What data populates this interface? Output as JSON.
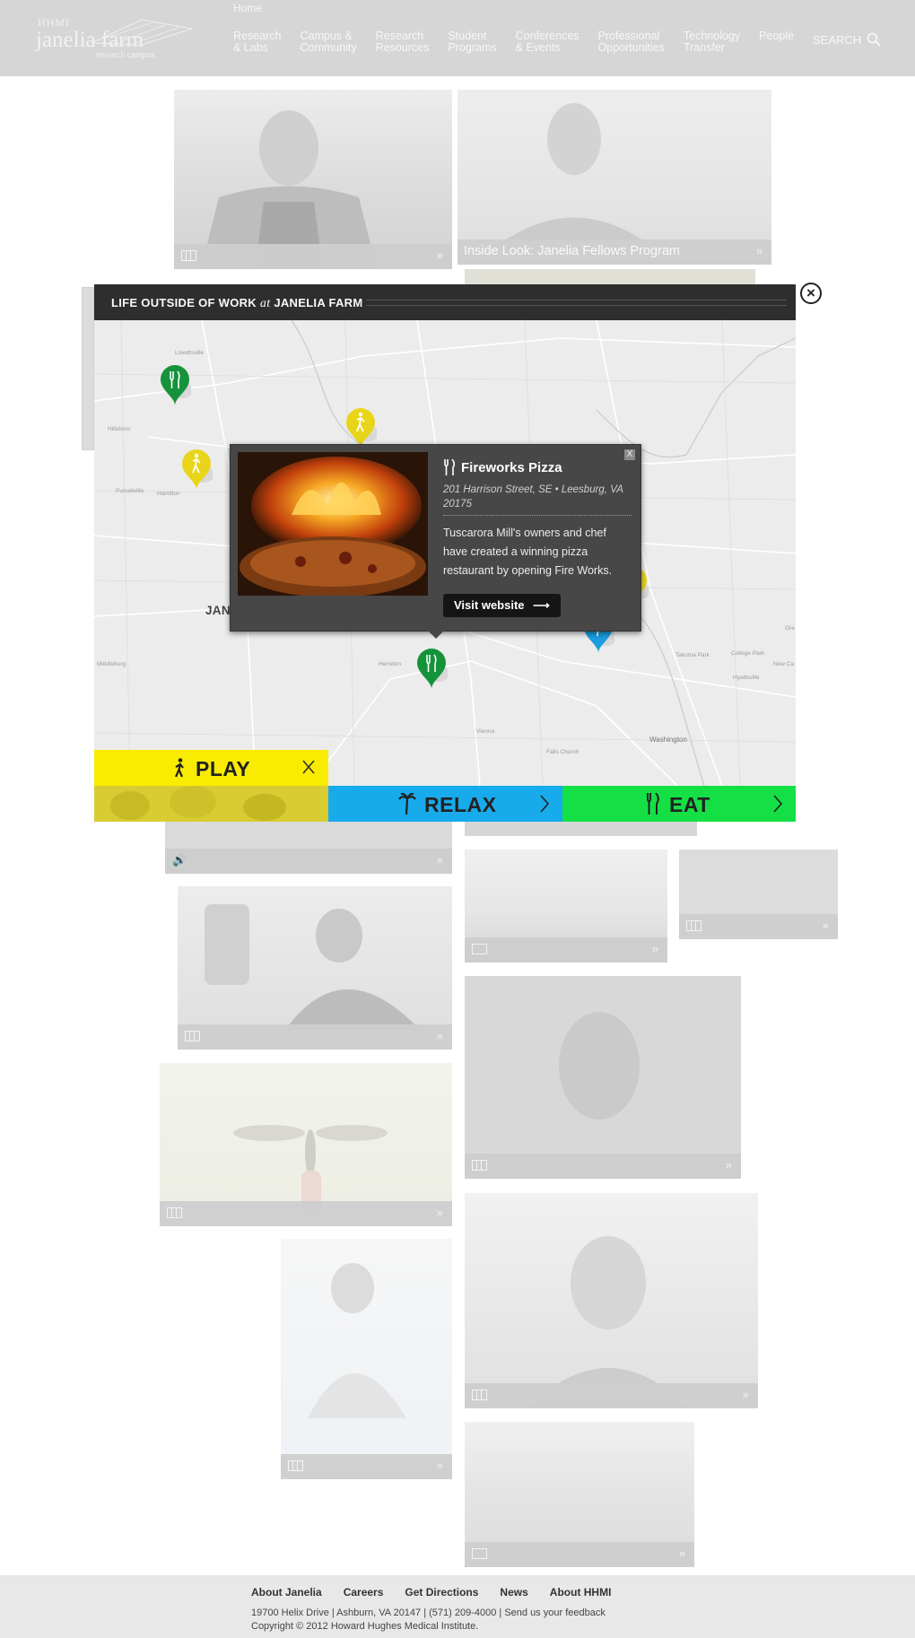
{
  "header": {
    "logo": {
      "hhmi": "HHMI",
      "name": "janelia farm",
      "sub": "research campus"
    },
    "home": "Home",
    "nav": [
      "Research\n& Labs",
      "Campus &\nCommunity",
      "Research\nResources",
      "Student\nPrograms",
      "Conferences\n& Events",
      "Professional\nOpportunities",
      "Technology\nTransfer",
      "People"
    ],
    "search": "SEARCH"
  },
  "tiles": {
    "fellows_caption": "Inside Look: Janelia Fellows Program"
  },
  "modal": {
    "title_pre": "LIFE OUTSIDE OF WORK ",
    "title_at": "at",
    "title_post": " JANELIA FARM",
    "map": {
      "janelia_label": "JANELIA FARM",
      "places": [
        "Lovettsville",
        "Hillsboro",
        "Purcellville",
        "Hamilton",
        "Middleburg",
        "Herndon",
        "Vienna",
        "Falls Church",
        "Washington",
        "Takoma Park",
        "College Park",
        "Hyattsville",
        "New Ca",
        "Gre"
      ],
      "pins": [
        {
          "category": "eat",
          "color": "#15933b",
          "icon": "fork-knife-icon"
        },
        {
          "category": "play",
          "color": "#e8d51a",
          "icon": "walker-icon"
        },
        {
          "category": "play",
          "color": "#e8d51a",
          "icon": "walker-icon"
        },
        {
          "category": "eat",
          "color": "#15933b",
          "icon": "fork-knife-icon"
        },
        {
          "category": "play",
          "color": "#e8d51a",
          "icon": "walker-icon"
        },
        {
          "category": "relax",
          "color": "#1a9ee0",
          "icon": "palm-icon"
        },
        {
          "category": "eat",
          "color": "#15933b",
          "icon": "fork-knife-icon"
        }
      ]
    },
    "popup": {
      "name": "Fireworks Pizza",
      "address": "201 Harrison Street, SE • Leesburg, VA 20175",
      "description": "Tuscarora Mill's owners and chef have created a winning pizza restaurant by opening Fire Works.",
      "button": "Visit website",
      "close": "X"
    },
    "categories": {
      "play": "PLAY",
      "relax": "RELAX",
      "eat": "EAT"
    }
  },
  "footer": {
    "links": [
      "About Janelia",
      "Careers",
      "Get Directions",
      "News",
      "About HHMI"
    ],
    "address": "19700 Helix Drive | Ashburn, VA 20147 | (571) 209-4000 | Send us your feedback",
    "copyright": "Copyright © 2012 Howard Hughes Medical Institute."
  },
  "colors": {
    "play": "#f9ec00",
    "relax": "#17abeb",
    "eat": "#14e045",
    "header_bg": "#d6d6d6",
    "modal_head": "#2e2e2e"
  }
}
